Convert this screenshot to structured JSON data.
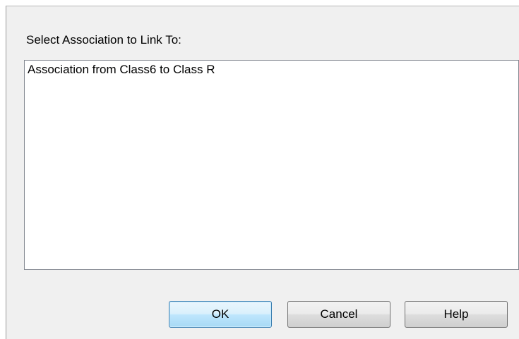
{
  "dialog": {
    "prompt_label": "Select Association to Link To:",
    "list": {
      "items": [
        "Association from Class6 to Class R"
      ],
      "selected_index": null
    },
    "buttons": {
      "ok_label": "OK",
      "cancel_label": "Cancel",
      "help_label": "Help"
    },
    "default_button": "ok",
    "colors": {
      "dialog_background": "#f0f0f0",
      "list_background": "#ffffff",
      "default_button_border": "#3c7fb1",
      "default_button_fill": "#bee6fd"
    }
  }
}
